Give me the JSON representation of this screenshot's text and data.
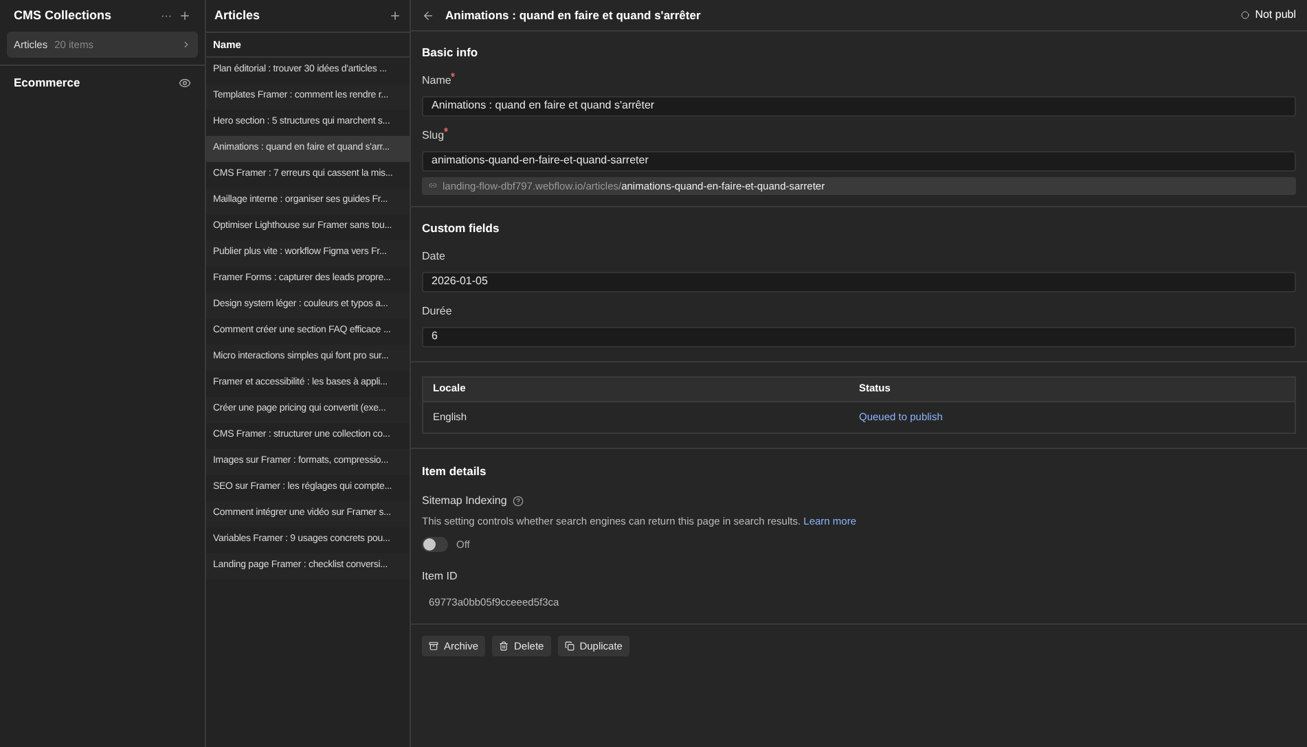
{
  "collections_panel": {
    "title": "CMS Collections",
    "more_icon_text": "···",
    "collections": [
      {
        "name": "Articles",
        "count": "20 items",
        "selected": true
      }
    ],
    "sections": [
      {
        "name": "Ecommerce"
      }
    ]
  },
  "articles_panel": {
    "title": "Articles",
    "column": "Name",
    "rows": [
      {
        "name": "Plan éditorial : trouver 30 idées d'articles ...",
        "selected": false
      },
      {
        "name": "Templates Framer : comment les rendre r...",
        "selected": false
      },
      {
        "name": "Hero section : 5 structures qui marchent s...",
        "selected": false
      },
      {
        "name": "Animations : quand en faire et quand s'arr...",
        "selected": true
      },
      {
        "name": "CMS Framer : 7 erreurs qui cassent la mis...",
        "selected": false
      },
      {
        "name": "Maillage interne : organiser ses guides Fr...",
        "selected": false
      },
      {
        "name": "Optimiser Lighthouse sur Framer sans tou...",
        "selected": false
      },
      {
        "name": "Publier plus vite : workflow Figma vers Fr...",
        "selected": false
      },
      {
        "name": "Framer Forms : capturer des leads propre...",
        "selected": false
      },
      {
        "name": "Design system léger : couleurs et typos a...",
        "selected": false
      },
      {
        "name": "Comment créer une section FAQ efficace ...",
        "selected": false
      },
      {
        "name": "Micro interactions simples qui font pro sur...",
        "selected": false
      },
      {
        "name": "Framer et accessibilité : les bases à appli...",
        "selected": false
      },
      {
        "name": "Créer une page pricing qui convertit (exe...",
        "selected": false
      },
      {
        "name": "CMS Framer : structurer une collection co...",
        "selected": false
      },
      {
        "name": "Images sur Framer : formats, compressio...",
        "selected": false
      },
      {
        "name": "SEO sur Framer : les réglages qui compte...",
        "selected": false
      },
      {
        "name": "Comment intégrer une vidéo sur Framer s...",
        "selected": false
      },
      {
        "name": "Variables Framer : 9 usages concrets pou...",
        "selected": false
      },
      {
        "name": "Landing page Framer : checklist conversi...",
        "selected": false
      }
    ]
  },
  "editor": {
    "title": "Animations : quand en faire et quand s'arrêter",
    "status": "Not publ",
    "basic_info": {
      "heading": "Basic info",
      "fields": [
        {
          "label": "Name",
          "required": true,
          "value": "Animations : quand en faire et quand s'arrêter"
        },
        {
          "label": "Slug",
          "required": true,
          "value": "animations-quand-en-faire-et-quand-sarreter"
        }
      ],
      "url_base": "landing-flow-dbf797.webflow.io/articles/",
      "url_slug": "animations-quand-en-faire-et-quand-sarreter"
    },
    "custom_fields": {
      "heading": "Custom fields",
      "fields": [
        {
          "label": "Date",
          "required": false,
          "value": "2026-01-05"
        },
        {
          "label": "Durée",
          "required": false,
          "value": "6"
        }
      ]
    },
    "locales": {
      "columns": [
        "Locale",
        "Status"
      ],
      "rows": [
        {
          "locale": "English",
          "status": "Queued to publish"
        }
      ]
    },
    "item_details": {
      "heading": "Item details",
      "sitemap_label": "Sitemap Indexing",
      "sitemap_help": "This setting controls whether search engines can return this page in search results.",
      "learn_more": "Learn more",
      "sitemap_on": false,
      "toggle_label": "Off",
      "id_label": "Item ID",
      "id_value": "69773a0bb05f9cceeed5f3ca"
    },
    "actions": [
      {
        "label": "Archive",
        "kind": "archive"
      },
      {
        "label": "Delete",
        "kind": "delete"
      },
      {
        "label": "Duplicate",
        "kind": "duplicate"
      }
    ]
  }
}
